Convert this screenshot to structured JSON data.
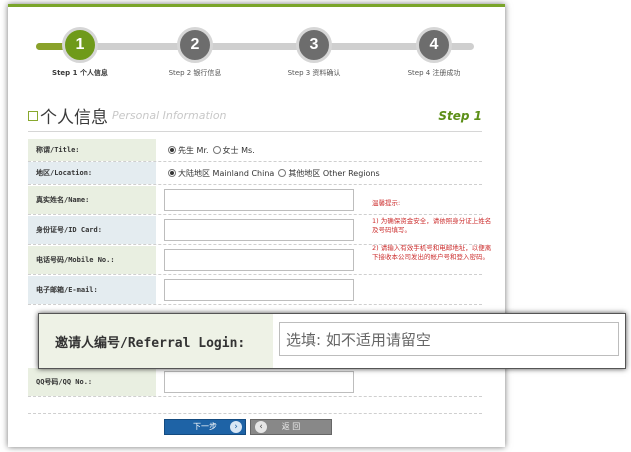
{
  "steps": [
    {
      "num": "1",
      "label": "Step 1 个人信息"
    },
    {
      "num": "2",
      "label": "Step 2 银行信息"
    },
    {
      "num": "3",
      "label": "Step 3 资料确认"
    },
    {
      "num": "4",
      "label": "Step 4 注册成功"
    }
  ],
  "heading": {
    "title": "个人信息",
    "subtitle": "Personal Information",
    "step": "Step 1"
  },
  "form": {
    "title_label": "称谓/Title:",
    "title_opt1": "先生 Mr.",
    "title_opt2": "女士 Ms.",
    "location_label": "地区/Location:",
    "location_opt1": "大陆地区 Mainland China",
    "location_opt2": "其他地区 Other Regions",
    "name_label": "真实姓名/Name:",
    "id_label": "身份证号/ID Card:",
    "mobile_label": "电话号码/Mobile No.:",
    "email_label": "电子邮箱/E-mail:",
    "qq_label": "QQ号码/QQ No.:"
  },
  "tips": {
    "title": "温馨提示:",
    "tip1": "1) 为确保资金安全，请依照身分证上姓名及号码填写。",
    "tip2": "2) 请输入有效手机号和电邮地址，以便离下接收本公司发出的帐户号和登入密码。"
  },
  "buttons": {
    "next": "下一步",
    "back": "返 回"
  },
  "callout": {
    "label": "邀请人编号/Referral Login:",
    "placeholder": "选填: 如不适用请留空"
  }
}
